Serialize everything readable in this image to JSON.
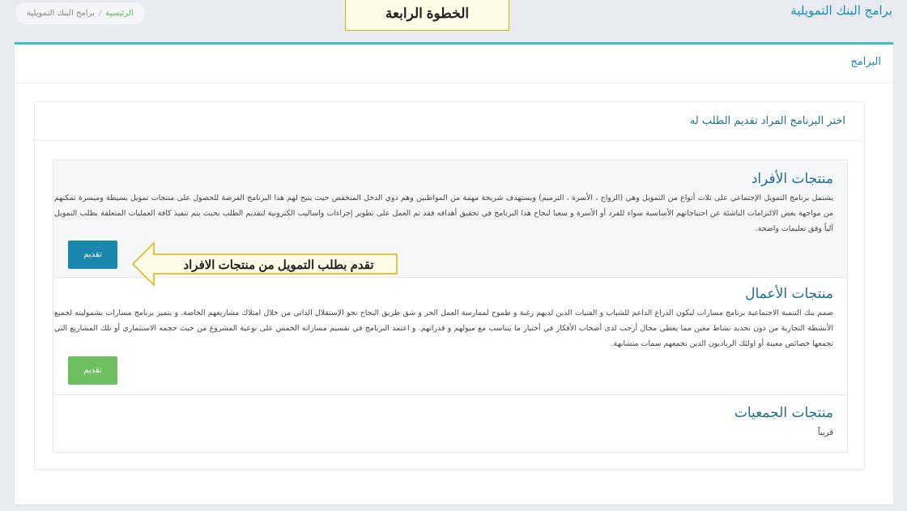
{
  "header": {
    "page_title": "برامج البنك التمويلية",
    "breadcrumb": {
      "home": "الرئيسية",
      "separator": "/",
      "current": "برامج البنك التمويلية"
    },
    "step_banner": "الخطوة الرابعة"
  },
  "main": {
    "title": "البرامج",
    "inner_title": "اختر البرنامج المراد تقديم الطلب له",
    "products": [
      {
        "title": "منتجات الأفراد",
        "description": "يشتمل برنامج التمويل الإجتماعي على ثلاث أنواع من التمويل وهي (الزواج ، الأسرة ، الترميم) ويستهدف شريحة مهمة من المواطنين وهم ذوي الدخل المنخفض حيث يتيح لهم هذا البرنامج الفرصة للحصول على منتجات تمويل بسيطة وميسرة تمكنهم من مواجهة بعض الالتزامات الناشئة عن احتياجاتهم الأساسية سواء للفرد أو الأسرة و سعيا لنجاح هذا البرنامج في تحقيق أهدافه فقد تم العمل على تطوير إجراءات واساليب الكترونية لتقديم الطلب بحيث يتم تنفيذ كافة العمليات المتعلقة بطلب التمويل آلياً وفق تعليمات واضحة.",
        "button": "تقديم"
      },
      {
        "title": "منتجات الأعمال",
        "description": "صمم بنك التنمية الاجتماعية برنامج مسارات ليكون الذراع الداعم للشباب و الفتيات الذين لديهم رغبة و طموح لممارسة العمل الحر و شق طريق النجاح نحو الإستقلال الذاتي من خلال امتلاك مشاريعهم الخاصة. و يتميز برنامج مسارات بشموليته لجميع الأنشطة التجارية من دون تحديد نشاط معين مما يعطي مجال أرحب لدى أصحاب الأفكار في أختيار ما يتناسب مع ميولهم و قدراتهم. و اعتمد البرنامج في تقسيم مساراته الخمس على نوعية المشروع من حيث حجمه الاستثماري أو تلك المشاريع التي تجمعها خصائص معينة أو اولئك الرياديون الذين تجمعهم سمات متشابهة.",
        "button": "تقديم"
      },
      {
        "title": "منتجات الجمعيات",
        "description": "قريباً"
      }
    ]
  },
  "annotation": {
    "callout_text": "تقدم بطلب التمويل من منتجات الافراد"
  },
  "colors": {
    "accent": "#1a88ae",
    "green": "#6ebf5f",
    "teal_border": "#3cc0c0",
    "banner_border": "#e0b100"
  }
}
